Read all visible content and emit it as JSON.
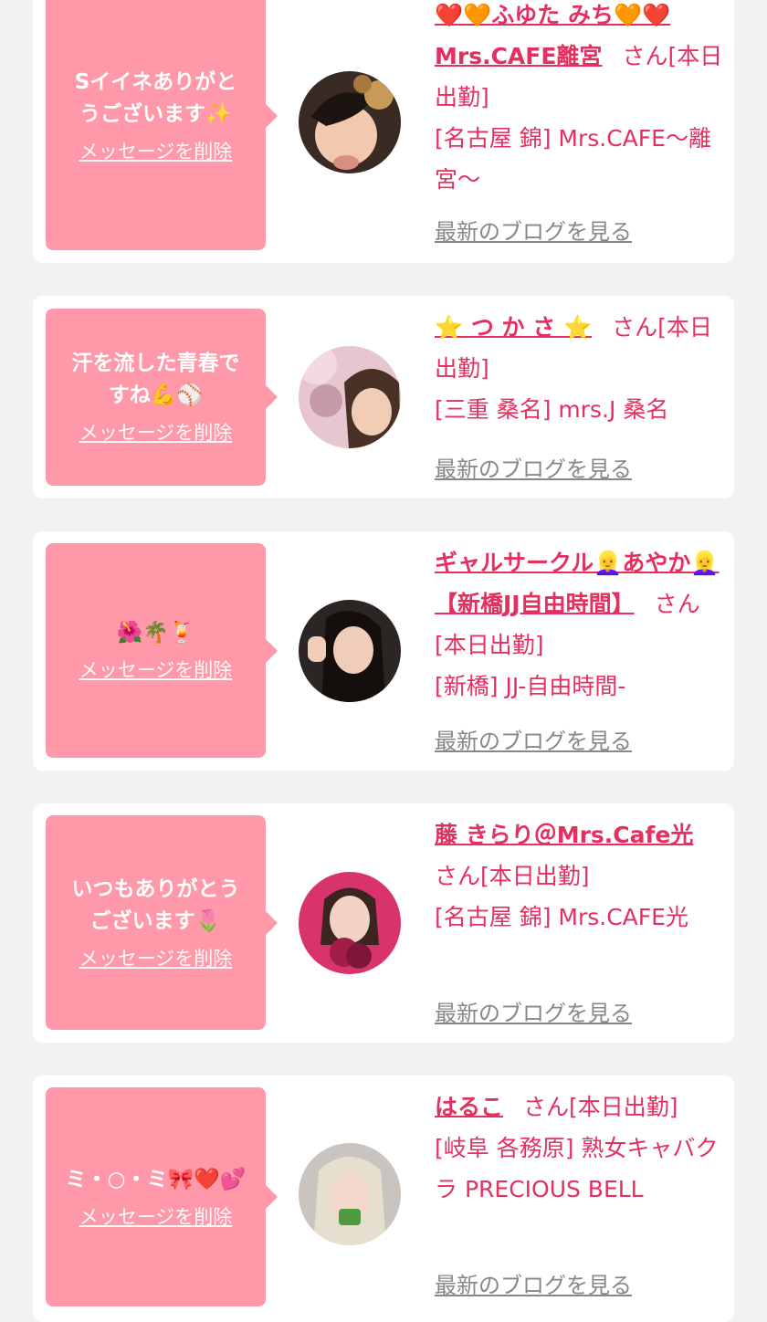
{
  "entries": [
    {
      "message": "Sイイネありがと\nうございます✨",
      "delete_label": "メッセージを削除",
      "name": "❤️🧡ふゆた みち🧡❤️\nMrs.CAFE離宮",
      "suffix": "さん[本日出勤]",
      "shop": "[名古屋 錦] Mrs.CAFE〜離宮〜",
      "blog_label": "最新のブログを見る"
    },
    {
      "message": "汗を流した青春で\nすね💪⚾",
      "delete_label": "メッセージを削除",
      "name": "⭐ つ か さ ⭐",
      "suffix": "さん[本日出勤]",
      "shop": "[三重 桑名] mrs.J 桑名",
      "blog_label": "最新のブログを見る"
    },
    {
      "message": "🌺🌴🍹",
      "delete_label": "メッセージを削除",
      "name": "ギャルサークル👱‍♀️あやか👱‍♀️【新橋JJ自由時間】",
      "suffix": "さん[本日出勤]",
      "shop": "[新橋] JJ-自由時間-",
      "blog_label": "最新のブログを見る"
    },
    {
      "message": "いつもありがとう\nございます🌷",
      "delete_label": "メッセージを削除",
      "name": "藤 きらり＠Mrs.Cafe光",
      "suffix": "さん[本日出勤]",
      "shop": "[名古屋 錦] Mrs.CAFE光",
      "blog_label": "最新のブログを見る"
    },
    {
      "message": "ミ・○・ミ🎀❤️💕",
      "delete_label": "メッセージを削除",
      "name": "はるこ",
      "suffix": "さん[本日出勤]",
      "shop": "[岐阜 各務原]  熟女キャバクラ PRECIOUS BELL",
      "blog_label": "最新のブログを見る"
    }
  ],
  "colors": {
    "page_bg": "#f2f2f2",
    "bubble": "#ff98a8",
    "accent": "#e4305f",
    "link_gray": "#888888"
  }
}
